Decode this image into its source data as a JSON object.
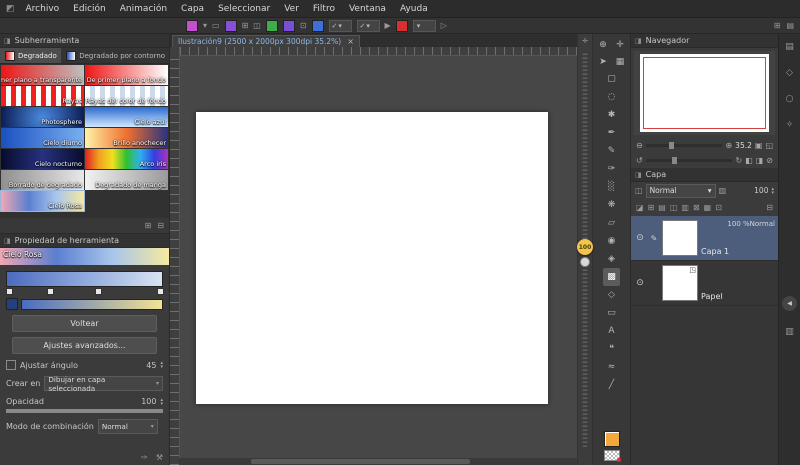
{
  "menubar": {
    "items": [
      "Archivo",
      "Edición",
      "Animación",
      "Capa",
      "Seleccionar",
      "Ver",
      "Filtro",
      "Ventana",
      "Ayuda"
    ]
  },
  "icons": {
    "app_logo": "◩",
    "panel": "◨",
    "dropdown": "▾",
    "spin_up": "▴",
    "spin_down": "▾",
    "check": "✓",
    "close": "×",
    "add": "⊞",
    "delete": "⊟",
    "eye": "⊙",
    "pencil": "✎",
    "paper": "◳",
    "zoom_out": "⊖",
    "zoom_in": "⊕",
    "fit": "▣",
    "actual": "◱",
    "rot_left": "↺",
    "rot_right": "↻",
    "flip_h": "◧",
    "flip_v": "◨",
    "reset": "⊘",
    "eyedropper": "✑",
    "wrench": "⚒",
    "cross": "✛",
    "collapse": "◀",
    "blend_combo": "◫",
    "opacity_icon": "▨",
    "trash": "⊟"
  },
  "cmd": {
    "items": [
      {
        "k": "swatch",
        "v": "#c24fd0"
      },
      {
        "k": "icon",
        "v": "▾"
      },
      {
        "k": "icon",
        "v": "▭"
      },
      {
        "k": "swatch",
        "v": "#8a4fd8"
      },
      {
        "k": "icon",
        "v": "⊞"
      },
      {
        "k": "icon",
        "v": "◫"
      },
      {
        "k": "swatch",
        "v": "#3fae49"
      },
      {
        "k": "swatch",
        "v": "#7a4fd8"
      },
      {
        "k": "icon",
        "v": "⊡"
      },
      {
        "k": "swatch",
        "v": "#3f6fd8"
      },
      {
        "k": "combo",
        "v": "✓"
      },
      {
        "k": "combo",
        "v": "✓"
      },
      {
        "k": "icon",
        "v": "▶"
      },
      {
        "k": "swatch",
        "v": "#d83030"
      },
      {
        "k": "combo",
        "v": ""
      },
      {
        "k": "icon",
        "v": "▷"
      }
    ],
    "right": [
      "⊞",
      "▤"
    ]
  },
  "subtool": {
    "title": "Subherramienta",
    "tabs": [
      {
        "label": "Degradado",
        "chip": "linear-gradient(90deg,#e02020,#ffffff)"
      },
      {
        "label": "Degradado por contorno",
        "chip": "linear-gradient(90deg,#2050c0,#ffffff)"
      }
    ],
    "items": [
      {
        "label": "De primer plano a transparente",
        "bg": "linear-gradient(90deg,#ee1515,rgba(238,21,21,0))"
      },
      {
        "label": "De primer plano a fondo",
        "bg": "linear-gradient(90deg,#ee1515,#ffffff)"
      },
      {
        "label": "Rayas",
        "bg": "repeating-linear-gradient(90deg,#ee2020 0 5px,#ffffff 5px 10px)"
      },
      {
        "label": "Rayas del color de fondo",
        "bg": "repeating-linear-gradient(90deg,#ffffff 0 5px,#ccd9ea 5px 10px)"
      },
      {
        "label": "Photosphere",
        "bg": "radial-gradient(circle at 50% 55%, #4a8ae0, #0a1a50)"
      },
      {
        "label": "Cielo azul",
        "bg": "linear-gradient(180deg,#2a6ad0,#cfe8ff)"
      },
      {
        "label": "Cielo diurno",
        "bg": "linear-gradient(90deg,#1a50c0,#7ab0f0)"
      },
      {
        "label": "Brillo anochecer",
        "bg": "linear-gradient(90deg,#fff2a8,#f07030,#28337e)"
      },
      {
        "label": "Cielo nocturno",
        "bg": "linear-gradient(90deg,#070c2c,#273180,#070c2c)"
      },
      {
        "label": "Arco iris",
        "bg": "linear-gradient(90deg,#e02020,#f0a020,#f0e020,#30c030,#30b0f0,#3040e0,#b030c0)"
      },
      {
        "label": "Borrado de degradado",
        "bg": "linear-gradient(90deg,#8f8f8f,#e8e8e8)"
      },
      {
        "label": "Degradado de manga",
        "bg": "linear-gradient(90deg,#f2f2f2,#9a9a9a)"
      },
      {
        "label": "Cielo Rosa",
        "bg": "linear-gradient(90deg,#f0a8b4,#5b7fd0,#a8c6ec,#f6e9a0)"
      }
    ]
  },
  "toolprop": {
    "title": "Propiedad de herramienta",
    "gradient_name": "Cielo Rosa",
    "preview_bg": "linear-gradient(90deg,#f0a8b4,#5b7fd0,#a8c6ec,#f6e9a0)",
    "editor_bg": "linear-gradient(90deg,#4a6cc0,#8fa9dc,#d8e2f2)",
    "chip_color": "#24407e",
    "result_bg": "linear-gradient(90deg,#4a6cc0,#f2e394)",
    "flip": "Voltear",
    "advanced": "Ajustes avanzados...",
    "angle_label": "Ajustar ángulo",
    "angle_value": "45",
    "create_label": "Crear en",
    "create_value": "Dibujar en capa seleccionada",
    "opacity_label": "Opacidad",
    "opacity_value": "100",
    "blend_label": "Modo de combinación",
    "blend_value": "Normal"
  },
  "document": {
    "tab": "Ilustración9 (2500 x 2000px 300dpi 35.2%)"
  },
  "slider": {
    "value": "100"
  },
  "tools": {
    "fg_color": "#f2a93b",
    "top": [
      {
        "name": "zoom",
        "glyph": "⊕"
      },
      {
        "name": "move",
        "glyph": "✛"
      },
      {
        "name": "operation",
        "glyph": "➤"
      },
      {
        "name": "select-layer",
        "glyph": "▦"
      }
    ],
    "main": [
      {
        "name": "marquee",
        "glyph": "▢"
      },
      {
        "name": "lasso",
        "glyph": "◌"
      },
      {
        "name": "auto-select",
        "glyph": "✱"
      },
      {
        "name": "pen",
        "glyph": "✒"
      },
      {
        "name": "pencil",
        "glyph": "✎"
      },
      {
        "name": "brush",
        "glyph": "✑"
      },
      {
        "name": "airbrush",
        "glyph": "░"
      },
      {
        "name": "decoration",
        "glyph": "❋"
      },
      {
        "name": "eraser",
        "glyph": "▱"
      },
      {
        "name": "blend",
        "glyph": "◉"
      },
      {
        "name": "fill",
        "glyph": "◈"
      },
      {
        "name": "gradient",
        "glyph": "▩"
      },
      {
        "name": "figure",
        "glyph": "◇"
      },
      {
        "name": "frame",
        "glyph": "▭"
      },
      {
        "name": "text",
        "glyph": "A"
      },
      {
        "name": "balloon",
        "glyph": "❝"
      },
      {
        "name": "correction",
        "glyph": "≈"
      },
      {
        "name": "ruler",
        "glyph": "╱"
      }
    ]
  },
  "navigator": {
    "title": "Navegador",
    "zoom": "35.2"
  },
  "layers": {
    "title": "Capa",
    "blend": "Normal",
    "opacity": "100",
    "icons": [
      "◪",
      "⊞",
      "▤",
      "◫",
      "▥",
      "⊠",
      "▦",
      "⊡"
    ],
    "rows": [
      {
        "info": "100 %Normal",
        "name": "Capa 1"
      },
      {
        "info": "",
        "name": "Papel"
      }
    ]
  },
  "edge": {
    "icons": [
      "▤",
      "◇",
      "○",
      "✧",
      "▥"
    ]
  }
}
